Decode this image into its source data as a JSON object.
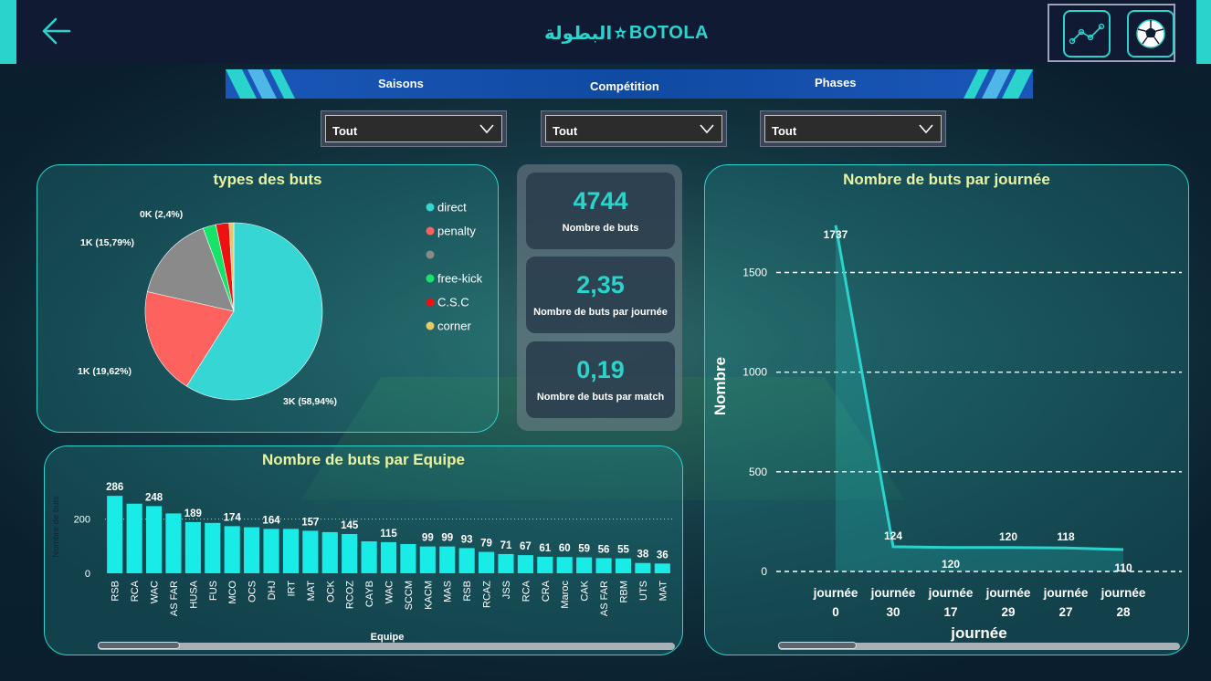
{
  "header": {
    "logo_arabic": "البطولة",
    "logo_text": "BOTOLA",
    "back_icon": "arrow-left-icon",
    "buttons": [
      {
        "icon": "line-chart-icon"
      },
      {
        "icon": "soccer-ball-icon"
      }
    ]
  },
  "filters": {
    "labels": [
      "Saisons",
      "Compétition",
      "Phases"
    ],
    "dropdowns": [
      {
        "value": "Tout"
      },
      {
        "value": "Tout"
      },
      {
        "value": "Tout"
      }
    ]
  },
  "kpis": [
    {
      "value": "4744",
      "label": "Nombre de buts"
    },
    {
      "value": "2,35",
      "label": "Nombre de buts par journée"
    },
    {
      "value": "0,19",
      "label": "Nombre de buts par match"
    }
  ],
  "colors": {
    "accent": "#2ad4cc",
    "title": "#e8f3a3",
    "bar": "#19ece6"
  },
  "chart_data": [
    {
      "type": "pie",
      "title": "types des buts",
      "legend_position": "right",
      "series": [
        {
          "name": "direct",
          "value": 58.94,
          "label": "3K (58,94%)",
          "color": "#36d6d4"
        },
        {
          "name": "penalty",
          "value": 19.62,
          "label": "1K (19,62%)",
          "color": "#fd625e"
        },
        {
          "name": "",
          "value": 15.79,
          "label": "1K (15,79%)",
          "color": "#8a8a8a"
        },
        {
          "name": "free-kick",
          "value": 2.4,
          "label": "",
          "color": "#17e36b"
        },
        {
          "name": "C.S.C",
          "value": 2.4,
          "label": "0K (2,4%)",
          "color": "#ee1111"
        },
        {
          "name": "corner",
          "value": 0.85,
          "label": "",
          "color": "#e8c96a"
        }
      ]
    },
    {
      "type": "bar",
      "title": "Nombre de buts par Equipe",
      "xlabel": "Equipe",
      "ylabel": "Nombre de buts",
      "ylim": [
        0,
        300
      ],
      "yticks": [
        0,
        200
      ],
      "categories": [
        "RSB",
        "RCA",
        "WAC",
        "AS FAR",
        "HUSA",
        "FUS",
        "MCO",
        "OCS",
        "DHJ",
        "IRT",
        "MAT",
        "OCK",
        "RCOZ",
        "CAYB",
        "WAC",
        "SCCM",
        "KACM",
        "MAS",
        "RSB",
        "RCAZ",
        "JSS",
        "RCA",
        "CRA",
        "Maroc",
        "CAK",
        "AS FAR",
        "RBM",
        "UTS",
        "MAT"
      ],
      "values": [
        286,
        257,
        248,
        221,
        189,
        186,
        174,
        170,
        164,
        164,
        157,
        152,
        145,
        118,
        115,
        108,
        99,
        99,
        93,
        79,
        71,
        67,
        61,
        60,
        59,
        56,
        55,
        38,
        36
      ],
      "data_labels": [
        "286",
        "",
        "248",
        "",
        "189",
        "",
        "174",
        "",
        "164",
        "",
        "157",
        "",
        "145",
        "",
        "115",
        "",
        "99",
        "99",
        "93",
        "79",
        "71",
        "67",
        "61",
        "60",
        "59",
        "56",
        "55",
        "38",
        "36"
      ]
    },
    {
      "type": "area",
      "title": "Nombre de buts par journée",
      "xlabel": "journée",
      "ylabel": "Nombre",
      "ylim": [
        0,
        1800
      ],
      "yticks": [
        0,
        500,
        1000,
        1500
      ],
      "categories": [
        [
          "journée",
          "0"
        ],
        [
          "journée",
          "30"
        ],
        [
          "journée",
          "17"
        ],
        [
          "journée",
          "29"
        ],
        [
          "journée",
          "27"
        ],
        [
          "journée",
          "28"
        ]
      ],
      "values": [
        1737,
        124,
        120,
        120,
        118,
        110
      ],
      "data_labels": [
        "1737",
        "124",
        "120",
        "120",
        "118",
        "110"
      ]
    }
  ]
}
